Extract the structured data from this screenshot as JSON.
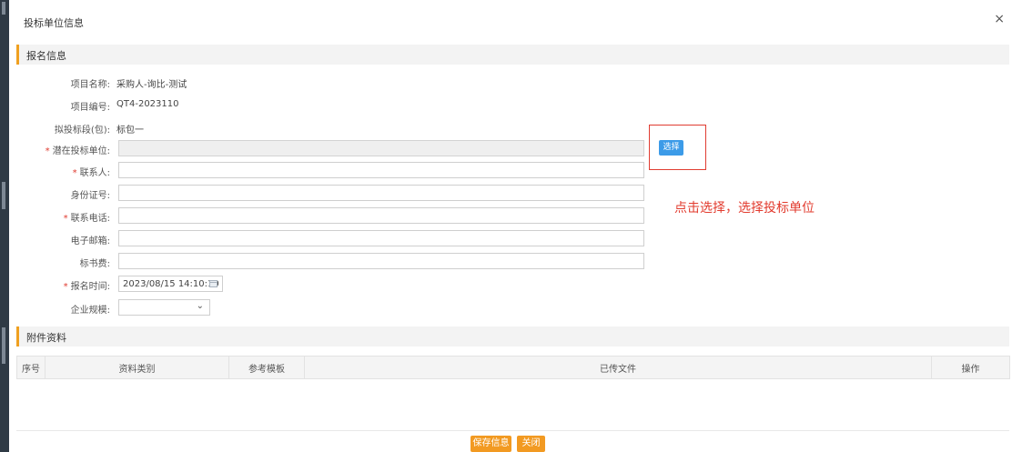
{
  "dialog": {
    "title": "投标单位信息",
    "close_glyph": "×"
  },
  "section_signup": {
    "title": "报名信息"
  },
  "fields": {
    "project_name": {
      "label": "项目名称:",
      "value": "采购人-询比-测试"
    },
    "project_code": {
      "label": "项目编号:",
      "value": "QT4-2023110"
    },
    "bid_package": {
      "label": "拟投标段(包):",
      "value": "标包一"
    },
    "bidder": {
      "required_mark": "*",
      "label": "潜在投标单位:",
      "value": ""
    },
    "contact": {
      "required_mark": "*",
      "label": "联系人:",
      "value": ""
    },
    "id_number": {
      "label": "身份证号:",
      "value": ""
    },
    "phone": {
      "required_mark": "*",
      "label": "联系电话:",
      "value": ""
    },
    "email": {
      "label": "电子邮箱:",
      "value": ""
    },
    "doc_fee": {
      "label": "标书费:",
      "value": ""
    },
    "signup_time": {
      "required_mark": "*",
      "label": "报名时间:",
      "value": "2023/08/15 14:10:10"
    },
    "company_size": {
      "label": "企业规模:",
      "value": "",
      "chevron": "⌄"
    }
  },
  "select_button": {
    "label": "选择"
  },
  "annotation": {
    "text": "点击选择，选择投标单位",
    "color": "#e23b2e"
  },
  "section_attachments": {
    "title": "附件资料"
  },
  "attachments_table": {
    "headers": [
      "序号",
      "资料类别",
      "参考模板",
      "已传文件",
      "操作"
    ],
    "rows": []
  },
  "footer": {
    "save_label": "保存信息",
    "close_label": "关闭"
  },
  "colors": {
    "accent": "#f0a020",
    "button_orange": "#f29a22",
    "select_blue": "#3c9be8",
    "required_red": "#e03c31"
  },
  "icons": {
    "close": "close-icon",
    "calendar": "calendar-icon",
    "dropdown": "chevron-down-icon"
  }
}
